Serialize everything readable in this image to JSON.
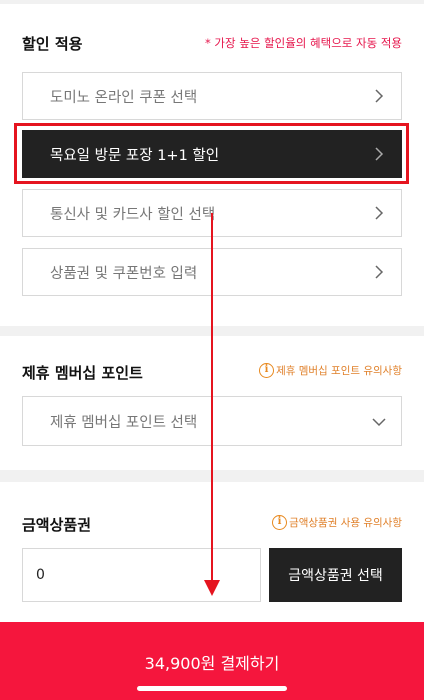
{
  "discount": {
    "title": "할인 적용",
    "note": "* 가장 높은 할인율의 혜택으로 자동 적용",
    "options": [
      "도미노 온라인 쿠폰 선택",
      "목요일 방문 포장 1+1 할인",
      "통신사 및 카드사 할인 선택",
      "상품권 및 쿠폰번호 입력"
    ]
  },
  "membership": {
    "title": "제휴 멤버십 포인트",
    "notice": "제휴 멤버십 포인트 유의사항",
    "select_label": "제휴 멤버십 포인트 선택"
  },
  "giftcard": {
    "title": "금액상품권",
    "notice": "금액상품권 사용 유의사항",
    "amount_value": "0",
    "select_button": "금액상품권 선택"
  },
  "payment": {
    "button_label": "34,900원 결제하기"
  },
  "colors": {
    "accent": "#f5163d",
    "highlight": "#e5141f",
    "warning": "#e8891f",
    "dark": "#222222"
  }
}
